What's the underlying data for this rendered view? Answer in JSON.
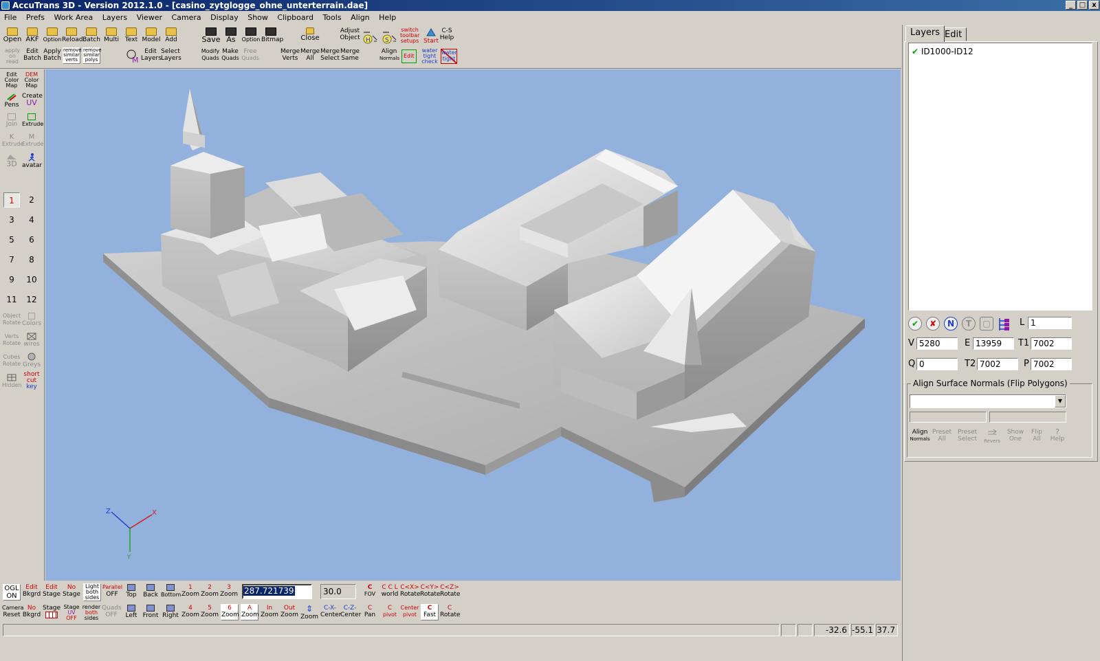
{
  "window": {
    "title": "AccuTrans 3D - Version 2012.1.0 - [casino_zytglogge_ohne_unterterrain.dae]",
    "minimize": "_",
    "maximize": "□",
    "close": "x"
  },
  "menu": [
    "File",
    "Prefs",
    "Work Area",
    "Layers",
    "Viewer",
    "Camera",
    "Display",
    "Show",
    "Clipboard",
    "Tools",
    "Align",
    "Help"
  ],
  "top_toolbar": {
    "row1": [
      {
        "label": "Open",
        "icon": "folder-icon"
      },
      {
        "label": "AKF",
        "icon": "folder-icon"
      },
      {
        "label": "Option",
        "icon": "folder-icon"
      },
      {
        "label": "Reload",
        "icon": "folder-icon"
      },
      {
        "label": "Batch",
        "icon": "folder-icon"
      },
      {
        "label": "Multi",
        "icon": "folder-icon"
      },
      {
        "label": "Text",
        "icon": "folder-icon"
      },
      {
        "label": "Model",
        "icon": "folder-icon"
      },
      {
        "label": "Add",
        "icon": "folder-icon"
      }
    ],
    "row2": [
      {
        "line1": "apply",
        "line2": "on",
        "line3": "read"
      },
      {
        "line1": "Edit",
        "line2": "Batch"
      },
      {
        "line1": "Apply",
        "line2": "Batch"
      },
      {
        "line1": "remove",
        "line2": "similar",
        "line3": "verts"
      },
      {
        "line1": "remove",
        "line2": "similar",
        "line3": "polys"
      }
    ],
    "layers_group": [
      {
        "line1": "Edit",
        "line2": "Layers"
      },
      {
        "line1": "Select",
        "line2": "Layers"
      }
    ],
    "save_group": [
      {
        "label": "Save",
        "icon": "disk-icon"
      },
      {
        "label": "As",
        "icon": "disk-icon"
      },
      {
        "label": "Option",
        "icon": "disk-icon"
      },
      {
        "label": "Bitmap",
        "icon": "disk-icon"
      }
    ],
    "quads_group": [
      {
        "line1": "Modify",
        "line2": "Quads"
      },
      {
        "line1": "Make",
        "line2": "Quads"
      },
      {
        "line1": "Free",
        "line2": "Quads"
      }
    ],
    "close_label": "Close",
    "merge_group": [
      {
        "line1": "Merge",
        "line2": "Verts"
      },
      {
        "line1": "Merge",
        "line2": "All"
      },
      {
        "line1": "Merge",
        "line2": "Select"
      },
      {
        "line1": "Merge",
        "line2": "Same"
      }
    ],
    "adjust_object": {
      "line1": "Adjust",
      "line2": "Object"
    },
    "align_normals": {
      "line1": "Align",
      "line2": "Normals"
    },
    "switch_toolbar": {
      "line1": "switch",
      "line2": "toolbar",
      "line3": "setups"
    },
    "start_label": "Start",
    "cs_help": {
      "line1": "C-S",
      "line2": "Help"
    },
    "edit_badge": "Edit",
    "water_tight_check": {
      "line1": "water",
      "line2": "tight",
      "line3": "check"
    },
    "water_tight_badge": {
      "line1": "water",
      "line2": "tight"
    }
  },
  "left_toolbar": {
    "tools": [
      {
        "line1": "Edit",
        "line2": "Color",
        "line3": "Map"
      },
      {
        "line1": "DEM",
        "line2": "Color",
        "line3": "Map"
      },
      {
        "line1": "Pens"
      },
      {
        "line1": "Create",
        "line2": "UV"
      },
      {
        "line1": "Join"
      },
      {
        "line1": "Extrude"
      },
      {
        "line1": "K",
        "line2": "Extrude"
      },
      {
        "line1": "M",
        "line2": "Extrude"
      },
      {
        "line1": "3D"
      },
      {
        "line1": "avatar"
      }
    ],
    "numbers": [
      "1",
      "2",
      "3",
      "4",
      "5",
      "6",
      "7",
      "8",
      "9",
      "10",
      "11",
      "12"
    ],
    "bottom_tools": [
      {
        "line1": "Object",
        "line2": "Rotate"
      },
      {
        "line1": "Colors"
      },
      {
        "line1": "Verts",
        "line2": "Rotate"
      },
      {
        "line1": "wires"
      },
      {
        "line1": "Cubes",
        "line2": "Rotate"
      },
      {
        "line1": "Greys"
      },
      {
        "line1": "Hidden"
      },
      {
        "line1": "short",
        "line2": "cut",
        "line3": "key"
      }
    ]
  },
  "right_panel": {
    "tabs": [
      "Layers",
      "Edit"
    ],
    "layers": [
      {
        "name": "ID1000-ID12",
        "checked": true
      }
    ],
    "icons": [
      "check-green-icon",
      "check-x-icon",
      "N",
      "T",
      "layer-icon",
      "tree-icon"
    ],
    "L_label": "L",
    "L_value": "1",
    "V_label": "V",
    "V_value": "5280",
    "E_label": "E",
    "E_value": "13959",
    "T1_label": "T1",
    "T1_value": "7002",
    "Q_label": "Q",
    "Q_value": "0",
    "T2_label": "T2",
    "T2_value": "7002",
    "P_label": "P",
    "P_value": "7002",
    "group_title": "Align Surface Normals (Flip Polygons)",
    "dropdown_value": "",
    "bottom_buttons": [
      {
        "line1": "Align",
        "line2": "Normals"
      },
      {
        "line1": "Preset",
        "line2": "All"
      },
      {
        "line1": "Preset",
        "line2": "Select"
      },
      {
        "line1": "Revers"
      },
      {
        "line1": "Show",
        "line2": "One"
      },
      {
        "line1": "Flip",
        "line2": "All"
      },
      {
        "line1": "Help"
      }
    ]
  },
  "bottom_toolbar": {
    "row1": [
      {
        "line1": "OGL",
        "line2": "ON"
      },
      {
        "line1": "Edit",
        "line2": "Bkgrd"
      },
      {
        "line1": "Edit",
        "line2": "Stage"
      },
      {
        "line1": "No",
        "line2": "Stage"
      },
      {
        "line1": "Light",
        "line2": "both",
        "line3": "sides"
      },
      {
        "line1": "Parallel",
        "line2": "OFF"
      },
      {
        "line1": "Top"
      },
      {
        "line1": "Back"
      },
      {
        "line1": "Bottom"
      },
      {
        "line1": "1",
        "line2": "Zoom"
      },
      {
        "line1": "2",
        "line2": "Zoom"
      },
      {
        "line1": "3",
        "line2": "Zoom"
      }
    ],
    "value_selected": "287.721739",
    "value_fov": "30.0",
    "row1_right": [
      {
        "line1": "C",
        "line2": "FOV"
      },
      {
        "line1": "C C L",
        "line2": "world"
      },
      {
        "line1": "C<X>",
        "line2": "Rotate"
      },
      {
        "line1": "C<Y>",
        "line2": "Rotate"
      },
      {
        "line1": "C<Z>",
        "line2": "Rotate"
      }
    ],
    "row2": [
      {
        "line1": "Camera",
        "line2": "Reset"
      },
      {
        "line1": "No",
        "line2": "Bkgrd"
      },
      {
        "line1": "Stage"
      },
      {
        "line1": "Stage",
        "line2": "UV",
        "line3": "OFF"
      },
      {
        "line1": "render",
        "line2": "both",
        "line3": "sides"
      },
      {
        "line1": "Quads",
        "line2": "OFF"
      },
      {
        "line1": "Left"
      },
      {
        "line1": "Front"
      },
      {
        "line1": "Right"
      },
      {
        "line1": "4",
        "line2": "Zoom"
      },
      {
        "line1": "5",
        "line2": "Zoom"
      },
      {
        "line1": "6",
        "line2": "Zoom"
      },
      {
        "line1": "A",
        "line2": "Zoom"
      },
      {
        "line1": "In",
        "line2": "Zoom"
      },
      {
        "line1": "Out",
        "line2": "Zoom"
      },
      {
        "line1": "Zoom"
      },
      {
        "line1": "C-X-",
        "line2": "Center"
      },
      {
        "line1": "C-Z-",
        "line2": "Center"
      },
      {
        "line1": "C",
        "line2": "Pan"
      },
      {
        "line1": "C",
        "line2": "pivot"
      },
      {
        "line1": "Center",
        "line2": "pivot"
      },
      {
        "line1": "C",
        "line2": "Fast"
      },
      {
        "line1": "C",
        "line2": "Rotate"
      }
    ]
  },
  "status": {
    "x": "-32.6",
    "y": "-55.1",
    "z": "37.7"
  },
  "axes": {
    "x": "X",
    "y": "Y",
    "z": "Z"
  },
  "colors": {
    "viewport_bg": "#93b1dd",
    "title_bar": "#0a246a",
    "accent_red": "#d00000",
    "accent_blue": "#1a3cd0"
  }
}
